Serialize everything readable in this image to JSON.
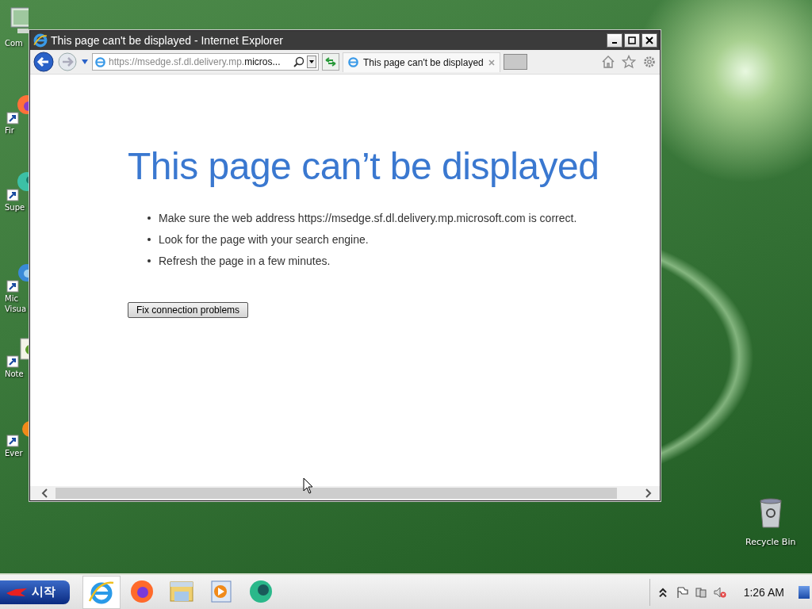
{
  "desktop_icons": [
    {
      "kind": "computer",
      "label": [
        "Com"
      ],
      "shortcut": false
    },
    {
      "kind": "firefox",
      "label": [
        "Fir"
      ],
      "shortcut": true
    },
    {
      "kind": "globe",
      "label": [
        "Supe"
      ],
      "shortcut": true
    },
    {
      "kind": "edge",
      "label": [
        "Mic",
        "Visua"
      ],
      "shortcut": true
    },
    {
      "kind": "notepad",
      "label": [
        "Note"
      ],
      "shortcut": true
    },
    {
      "kind": "orange",
      "label": [
        "Ever"
      ],
      "shortcut": true
    }
  ],
  "recycle_bin": {
    "label": "Recycle Bin"
  },
  "window": {
    "title": "This page can't be displayed - Internet Explorer",
    "address": "https://msedge.sf.dl.delivery.mp.**micros...**",
    "tabs": [
      {
        "title": "This page can't be displayed",
        "selected": true
      }
    ],
    "heading": "This page can’t be displayed",
    "bullets": [
      "Make sure the web address https://msedge.sf.dl.delivery.mp.microsoft.com is correct.",
      "Look for the page with your search engine.",
      "Refresh the page in a few minutes."
    ],
    "button": "Fix connection problems"
  },
  "taskbar": {
    "start": "시작",
    "apps": [
      {
        "kind": "ie",
        "selected": true
      },
      {
        "kind": "firefox",
        "selected": false
      },
      {
        "kind": "folder",
        "selected": false
      },
      {
        "kind": "media",
        "selected": false
      },
      {
        "kind": "globe",
        "selected": false
      }
    ],
    "clock": "1:26 AM"
  }
}
